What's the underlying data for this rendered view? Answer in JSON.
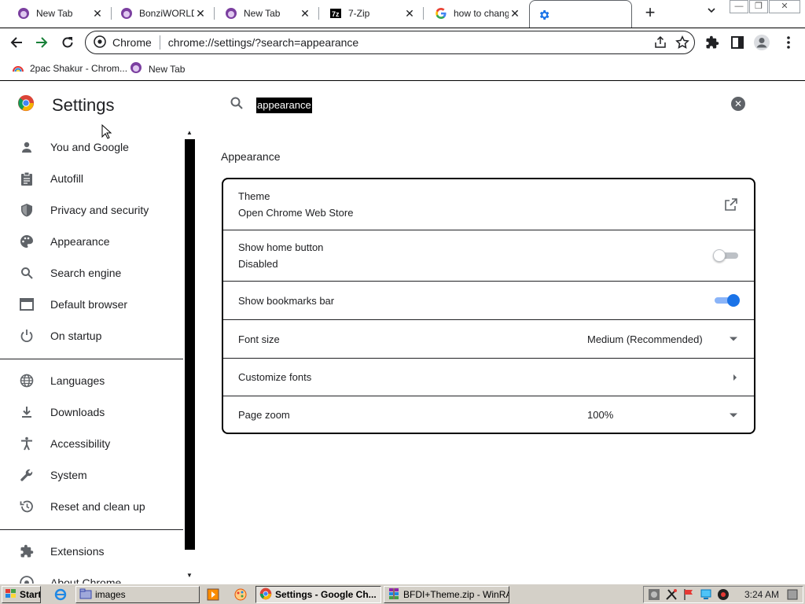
{
  "tabs": [
    {
      "title": "New Tab",
      "icon": "bonzi-favicon"
    },
    {
      "title": "BonziWORLD",
      "icon": "bonzi-favicon"
    },
    {
      "title": "New Tab",
      "icon": "bonzi-favicon"
    },
    {
      "title": "7-Zip",
      "icon": "7zip-favicon"
    },
    {
      "title": "how to chang",
      "icon": "google-favicon"
    },
    {
      "title": "",
      "icon": "gear-icon",
      "active": true
    }
  ],
  "omnibox": {
    "site_label": "Chrome",
    "url": "chrome://settings/?search=appearance"
  },
  "bookmarks": [
    {
      "label": "2pac Shakur - Chrom...",
      "icon": "rainbow-favicon"
    },
    {
      "label": "New Tab",
      "icon": "bonzi-favicon"
    }
  ],
  "settings": {
    "title": "Settings",
    "search_query": "appearance",
    "nav": [
      {
        "label": "You and Google",
        "icon": "person-icon"
      },
      {
        "label": "Autofill",
        "icon": "clipboard-icon"
      },
      {
        "label": "Privacy and security",
        "icon": "shield-icon"
      },
      {
        "label": "Appearance",
        "icon": "palette-icon"
      },
      {
        "label": "Search engine",
        "icon": "search-icon"
      },
      {
        "label": "Default browser",
        "icon": "browser-icon"
      },
      {
        "label": "On startup",
        "icon": "power-icon"
      },
      {
        "label": "Languages",
        "icon": "globe-icon"
      },
      {
        "label": "Downloads",
        "icon": "download-icon"
      },
      {
        "label": "Accessibility",
        "icon": "accessibility-icon"
      },
      {
        "label": "System",
        "icon": "wrench-icon"
      },
      {
        "label": "Reset and clean up",
        "icon": "history-icon"
      },
      {
        "label": "Extensions",
        "icon": "puzzle-icon"
      },
      {
        "label": "About Chrome",
        "icon": "chrome-icon"
      }
    ],
    "section_title": "Appearance",
    "rows": {
      "theme": {
        "label": "Theme",
        "sub": "Open Chrome Web Store"
      },
      "home_button": {
        "label": "Show home button",
        "sub": "Disabled",
        "enabled": false
      },
      "bookmarks_bar": {
        "label": "Show bookmarks bar",
        "enabled": true
      },
      "font_size": {
        "label": "Font size",
        "value": "Medium (Recommended)"
      },
      "customize_fonts": {
        "label": "Customize fonts"
      },
      "page_zoom": {
        "label": "Page zoom",
        "value": "100%"
      }
    }
  },
  "taskbar": {
    "start_label": "Start",
    "buttons": [
      {
        "label": "images",
        "icon": "folder-icon"
      },
      {
        "label": "Settings - Google Ch...",
        "icon": "chrome-icon",
        "active": true
      },
      {
        "label": "BFDI+Theme.zip - WinRA...",
        "icon": "winrar-icon"
      }
    ],
    "clock": "3:24 AM"
  },
  "colors": {
    "accent": "#1a73e8",
    "text": "#202124",
    "taskbar": "#d4d0c8"
  }
}
